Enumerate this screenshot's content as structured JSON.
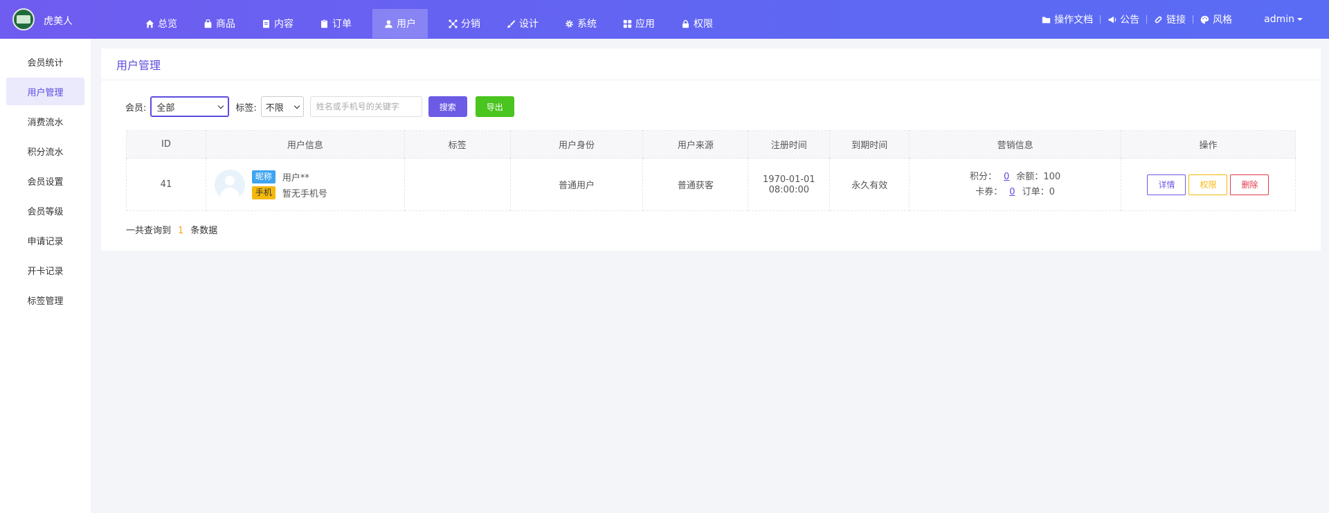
{
  "header": {
    "brand": "虎美人",
    "nav": [
      {
        "label": "总览",
        "icon": "home-icon"
      },
      {
        "label": "商品",
        "icon": "bag-icon"
      },
      {
        "label": "内容",
        "icon": "document-icon"
      },
      {
        "label": "订单",
        "icon": "clipboard-icon"
      },
      {
        "label": "用户",
        "icon": "user-icon",
        "active": true
      },
      {
        "label": "分销",
        "icon": "network-icon"
      },
      {
        "label": "设计",
        "icon": "brush-icon"
      },
      {
        "label": "系统",
        "icon": "gear-icon"
      },
      {
        "label": "应用",
        "icon": "grid-icon"
      },
      {
        "label": "权限",
        "icon": "lock-icon"
      }
    ],
    "right": {
      "docs": "操作文档",
      "notice": "公告",
      "link": "链接",
      "style": "风格",
      "user": "admin"
    }
  },
  "sidebar": {
    "items": [
      {
        "label": "会员统计"
      },
      {
        "label": "用户管理",
        "active": true
      },
      {
        "label": "消费流水"
      },
      {
        "label": "积分流水"
      },
      {
        "label": "会员设置"
      },
      {
        "label": "会员等级"
      },
      {
        "label": "申请记录"
      },
      {
        "label": "开卡记录"
      },
      {
        "label": "标签管理"
      }
    ]
  },
  "main": {
    "title": "用户管理",
    "filters": {
      "member_label": "会员:",
      "member_value": "全部",
      "tag_label": "标签:",
      "tag_value": "不限",
      "keyword_placeholder": "姓名或手机号的关键字",
      "search_label": "搜索",
      "export_label": "导出"
    },
    "table": {
      "headers": [
        "ID",
        "用户信息",
        "标签",
        "用户身份",
        "用户来源",
        "注册时间",
        "到期时间",
        "营销信息",
        "操作"
      ],
      "rows": [
        {
          "id": "41",
          "nickname_badge": "昵称",
          "nickname": "用户**",
          "phone_badge": "手机",
          "phone": "暂无手机号",
          "tag": "",
          "identity": "普通用户",
          "source": "普通获客",
          "reg_date": "1970-01-01",
          "reg_time": "08:00:00",
          "expire": "永久有效",
          "points_label": "积分：",
          "points": "0",
          "balance_label": "余额：",
          "balance": "100",
          "coupon_label": "卡券：",
          "coupon": "0",
          "orders_label": "订单：",
          "orders": "0",
          "actions": {
            "detail": "详情",
            "permission": "权限",
            "delete": "删除"
          }
        }
      ]
    },
    "summary": {
      "prefix": "一共查询到",
      "count": "1",
      "suffix": "条数据"
    }
  },
  "colors": {
    "primary": "#6c5be5",
    "export_green": "#4ac41f",
    "danger": "#e23a4a",
    "warning": "#f5b90c",
    "info_blue": "#3fa4f0"
  }
}
